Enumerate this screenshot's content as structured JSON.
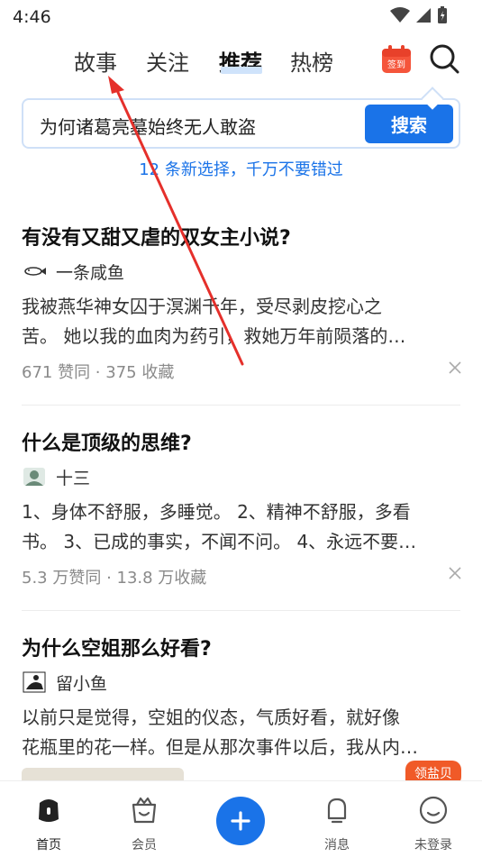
{
  "status": {
    "time": "4:46"
  },
  "nav": {
    "tabs": [
      {
        "label": "故事"
      },
      {
        "label": "关注"
      },
      {
        "label": "推荐"
      },
      {
        "label": "热榜"
      }
    ],
    "checkin_label": "签到"
  },
  "search": {
    "query": "为何诸葛亮墓始终无人敢盗",
    "button": "搜索"
  },
  "banner": "12 条新选择，千万不要错过",
  "feed": [
    {
      "title": "有没有又甜又虐的双女主小说?",
      "author": "一条咸鱼",
      "excerpt_line1": "我被燕华神女囚于溟渊千年，受尽剥皮挖心之",
      "excerpt_line2": "苦。 她以我的血肉为药引，救她万年前陨落的…",
      "stats": "671 赞同 · 375 收藏"
    },
    {
      "title": "什么是顶级的思维?",
      "author": "十三",
      "excerpt_line1": "1、身体不舒服，多睡觉。 2、精神不舒服，多看",
      "excerpt_line2": "书。 3、已成的事实，不闻不问。 4、永远不要…",
      "stats": "5.3 万赞同 · 13.8 万收藏"
    },
    {
      "title": "为什么空姐那么好看?",
      "author": "留小鱼",
      "excerpt_line1": "以前只是觉得，空姐的仪态，气质好看，就好像",
      "excerpt_line2": "花瓶里的花一样。但是从那次事件以后，我从内…",
      "stats": ""
    }
  ],
  "bottom_nav": {
    "items": [
      {
        "label": "首页"
      },
      {
        "label": "会员"
      },
      {
        "label": "消息"
      },
      {
        "label": "未登录"
      }
    ],
    "promo": "领盐贝"
  },
  "colors": {
    "accent": "#1a73e8",
    "annotation": "#e5302b",
    "promo": "#f05a28"
  }
}
